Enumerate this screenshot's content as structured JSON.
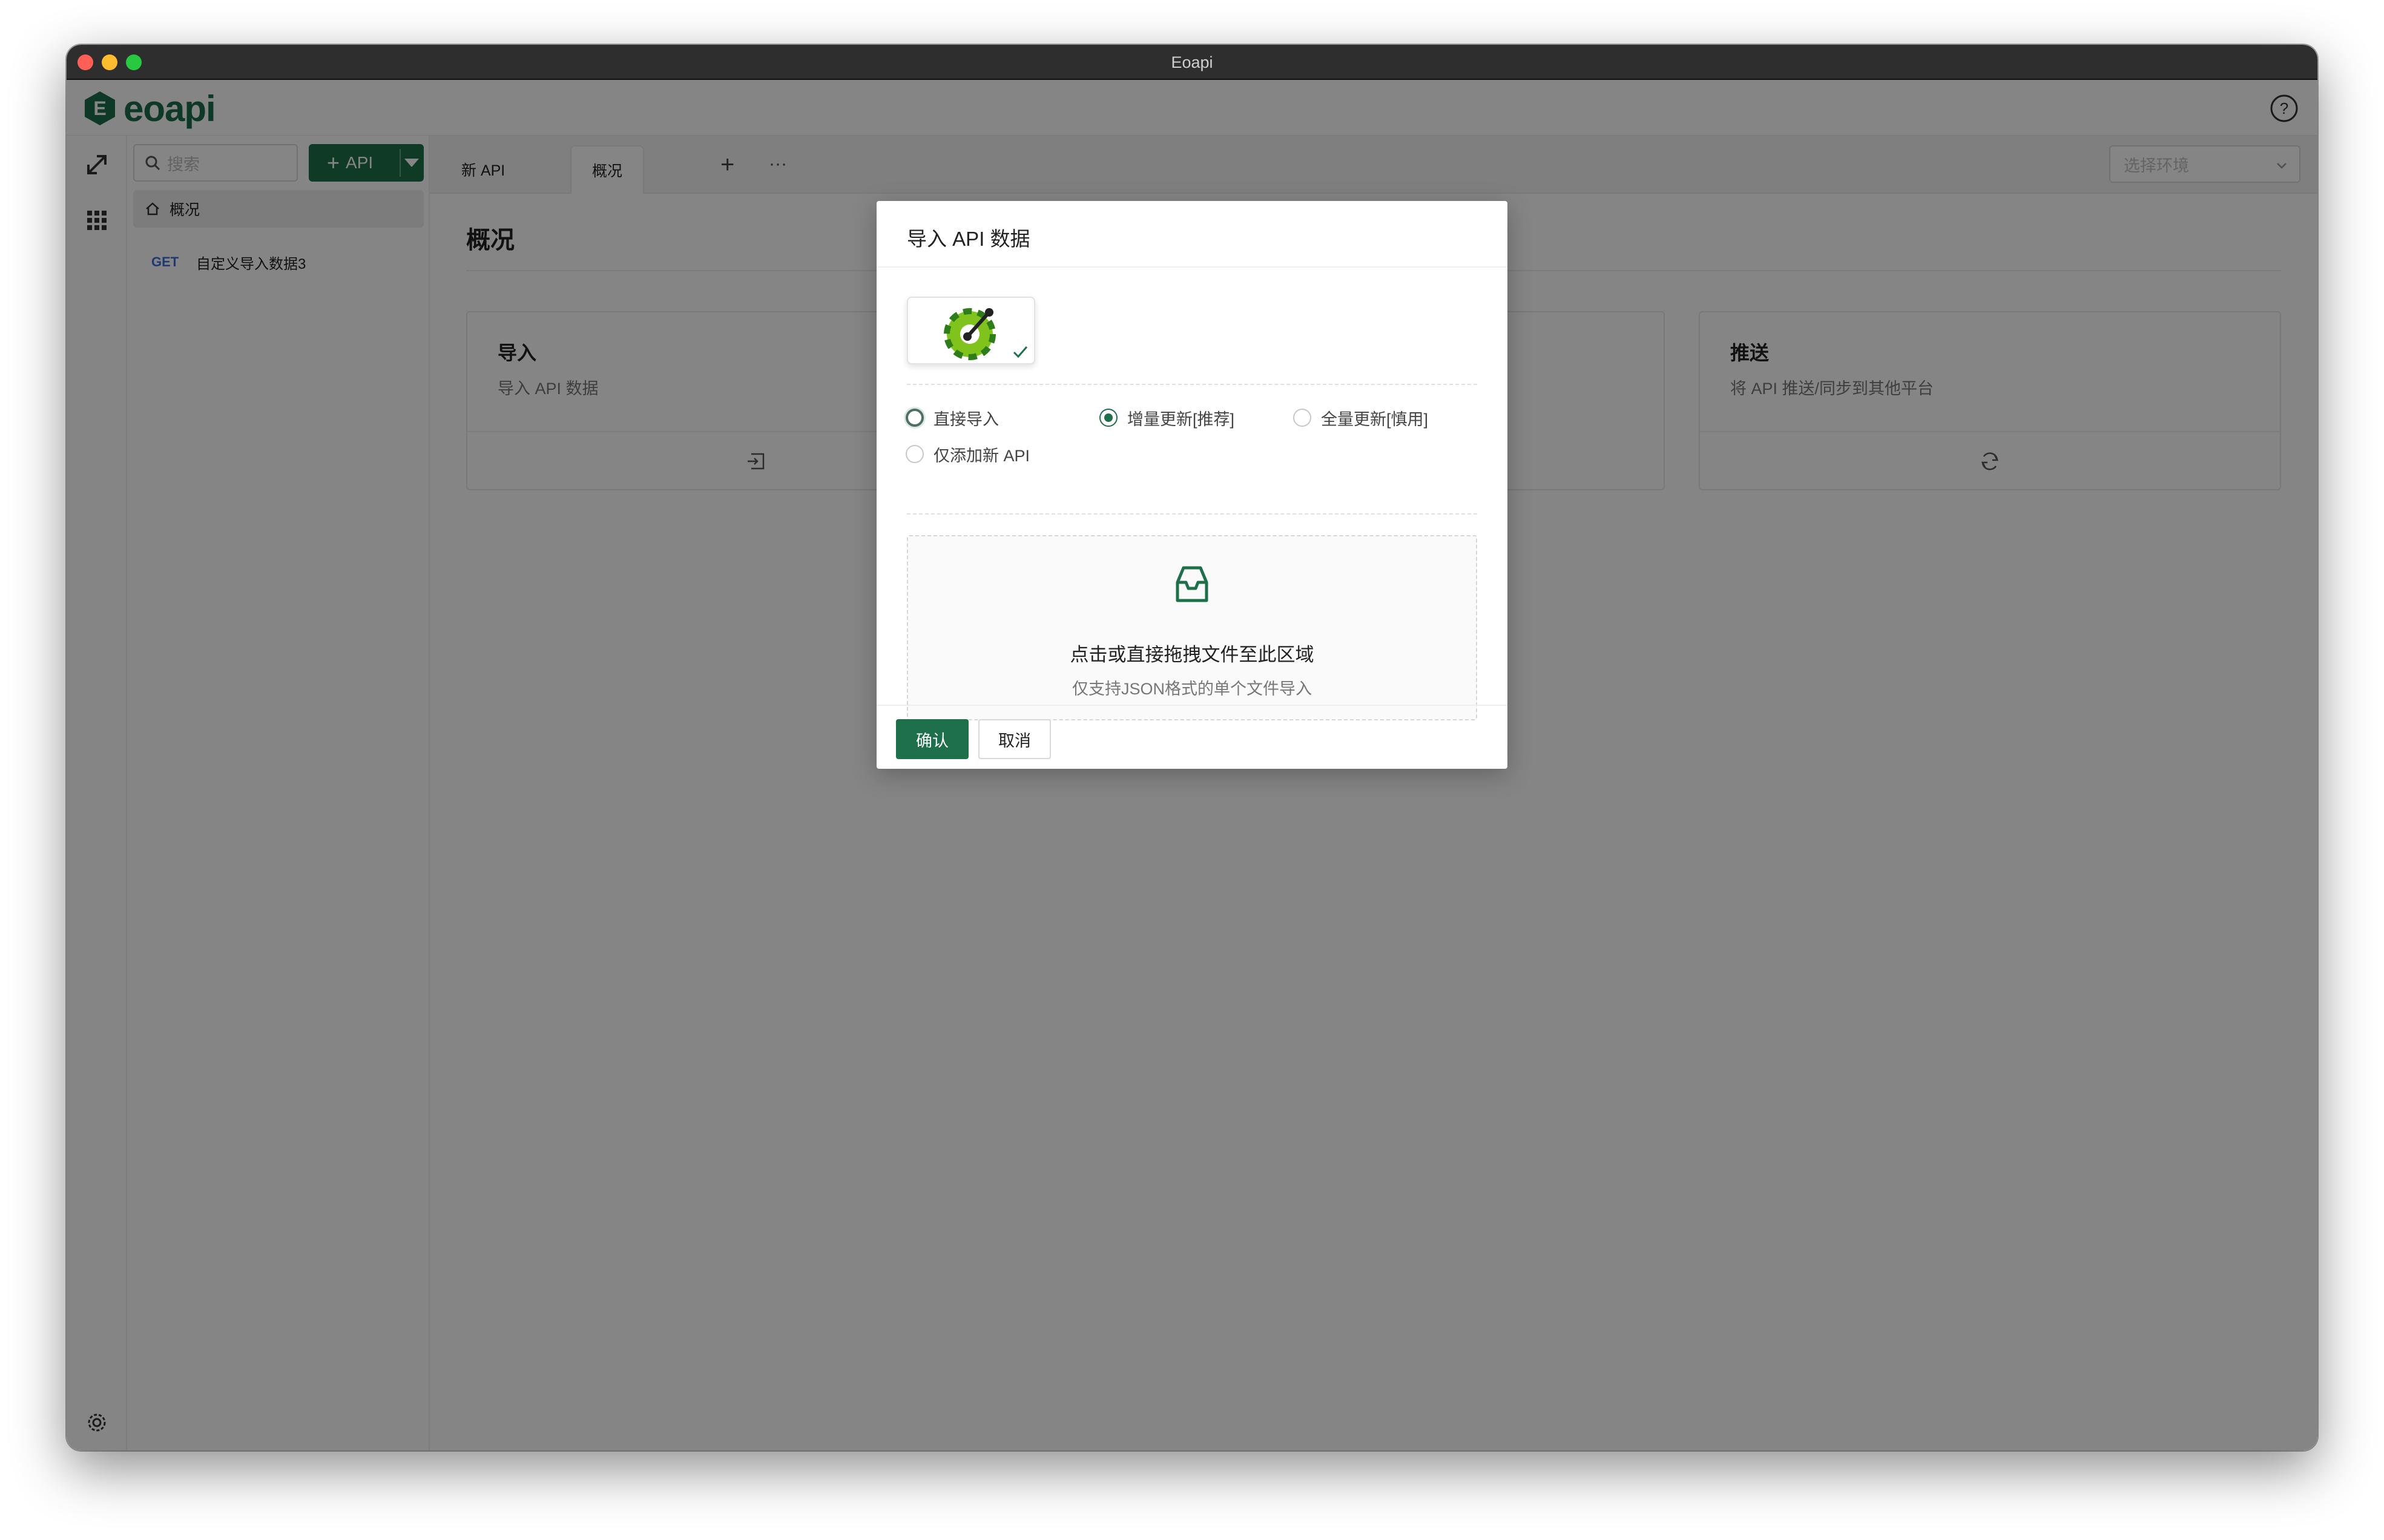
{
  "window": {
    "title": "Eoapi"
  },
  "app": {
    "logo_text": "eoapi"
  },
  "sidebar": {
    "search_placeholder": "搜索",
    "add_button_label": "API",
    "overview_label": "概况",
    "items": [
      {
        "method": "GET",
        "name": "自定义导入数据3"
      }
    ]
  },
  "tabs": [
    {
      "label": "新 API"
    },
    {
      "label": "概况"
    }
  ],
  "tab_more": "···",
  "env_select": {
    "placeholder": "选择环境"
  },
  "main": {
    "title": "概况",
    "cards": [
      {
        "title": "导入",
        "desc": "导入 API 数据",
        "icon": "import-icon"
      },
      {
        "title": "推送",
        "desc": "将 API 推送/同步到其他平台",
        "icon": "sync-icon"
      }
    ]
  },
  "modal": {
    "title": "导入 API 数据",
    "format_selected": "swagger-logo-icon",
    "options": [
      {
        "label": "直接导入",
        "checked": false
      },
      {
        "label": "增量更新[推荐]",
        "checked": true
      },
      {
        "label": "全量更新[慎用]",
        "checked": false
      },
      {
        "label": "仅添加新 API",
        "checked": false
      }
    ],
    "dropzone": {
      "title": "点击或直接拖拽文件至此区域",
      "hint": "仅支持JSON格式的单个文件导入"
    },
    "confirm_label": "确认",
    "cancel_label": "取消"
  },
  "colors": {
    "brand": "#1d7049",
    "method_get": "#3a6fd6"
  }
}
